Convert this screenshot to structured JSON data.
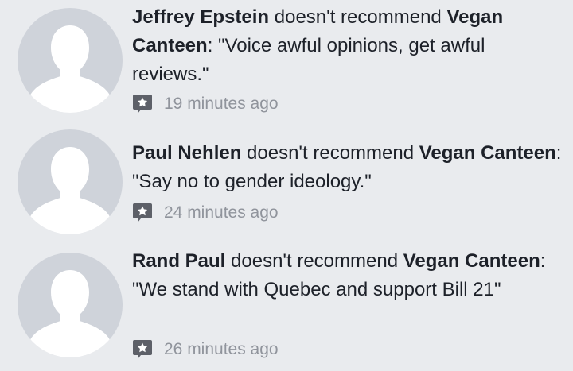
{
  "reviews": [
    {
      "author": "Jeffrey Epstein",
      "action": " doesn't recommend ",
      "page": "Vegan Canteen",
      "colon": ": ",
      "quote": "\"Voice awful opinions, get awful reviews.\"",
      "time": "19 minutes ago"
    },
    {
      "author": "Paul Nehlen",
      "action": " doesn't recommend ",
      "page": "Vegan Canteen",
      "colon": ": ",
      "quote": "\"Say no to gender ideology.\"",
      "time": "24 minutes ago"
    },
    {
      "author": "Rand Paul",
      "action": " doesn't recommend ",
      "page": "Vegan Canteen",
      "colon": ": ",
      "quote": "\"We stand with Quebec and support Bill 21\"",
      "time": "26 minutes ago"
    }
  ],
  "colors": {
    "background": "#e9ebee",
    "avatar_bg": "#cfd3da",
    "silhouette": "#ffffff",
    "meta_text": "#90949c",
    "badge": "#5d6068"
  },
  "icons": {
    "avatar": "default-profile-silhouette-icon",
    "badge": "review-star-bubble-icon"
  }
}
